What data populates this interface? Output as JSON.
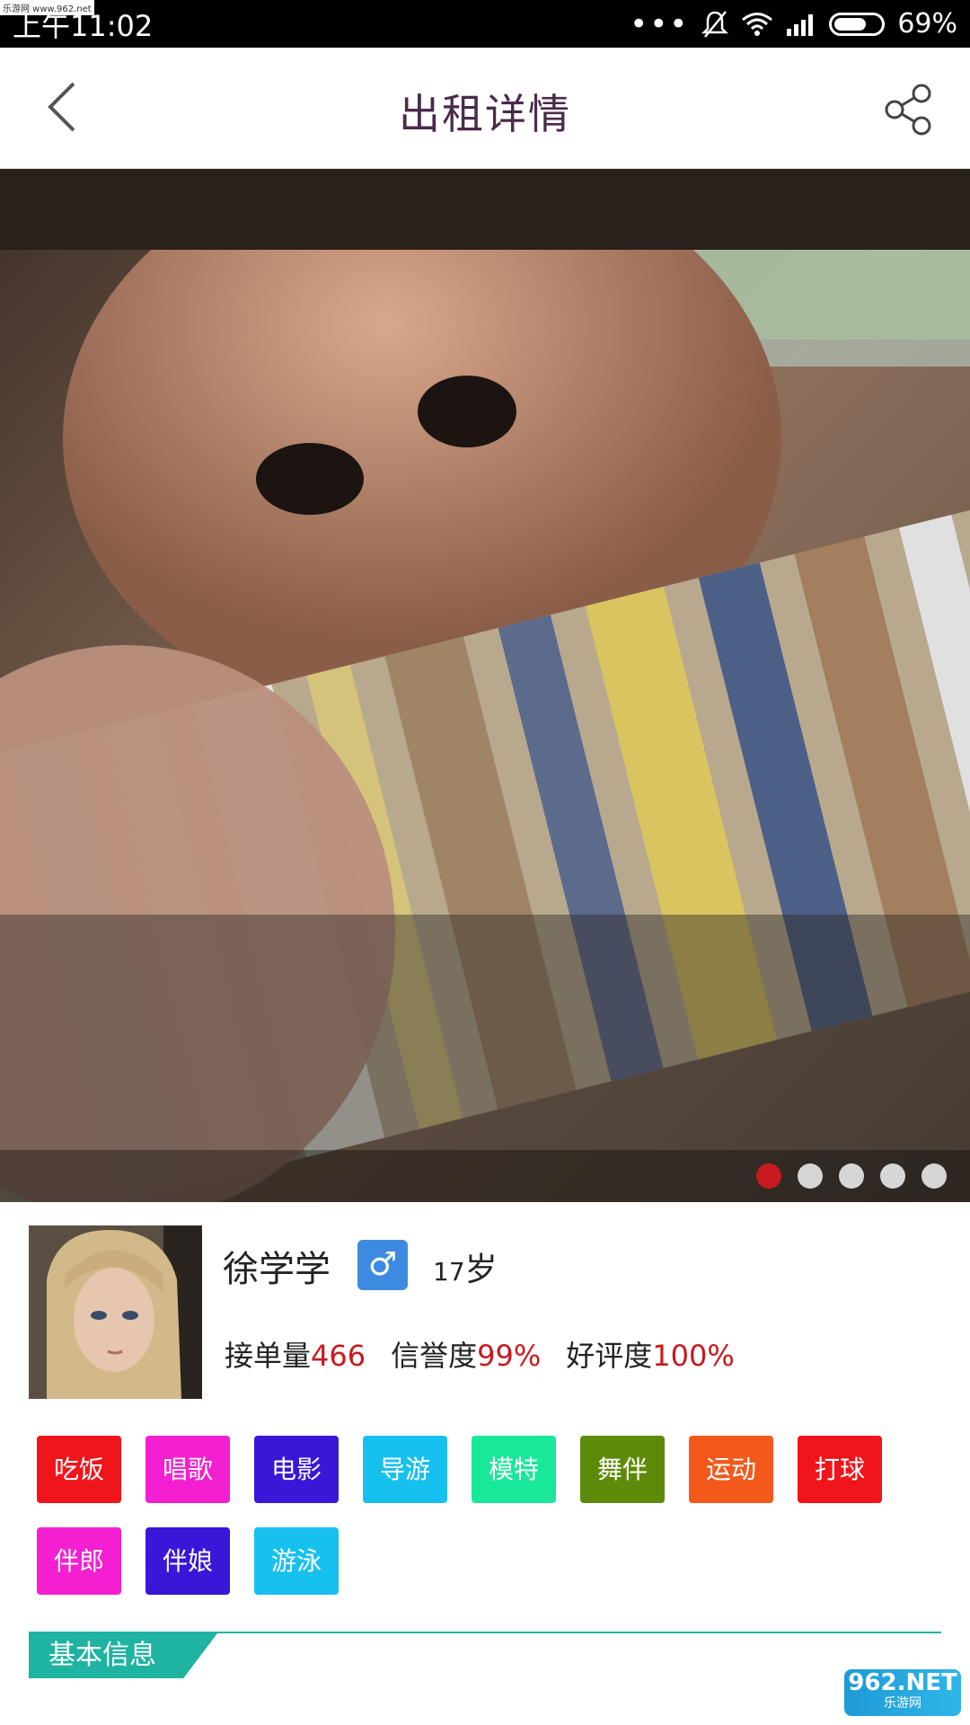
{
  "status_bar": {
    "time": "上午11:02",
    "battery": "69%",
    "battery_level": 0.69,
    "watermark_top": "乐游网 www.962.net"
  },
  "header": {
    "title": "出租详情",
    "back_icon": "chevron-left-icon",
    "share_icon": "share-icon"
  },
  "carousel": {
    "total": 5,
    "active_index": 0,
    "active_color": "#c8191e"
  },
  "profile": {
    "name": "徐学学",
    "gender_symbol": "♂",
    "age_number": "17",
    "age_unit": "岁",
    "stats": [
      {
        "label": "接单量",
        "value": "466"
      },
      {
        "label": "信誉度",
        "value": "99%"
      },
      {
        "label": "好评度",
        "value": "100%"
      }
    ]
  },
  "tags": [
    {
      "label": "吃饭",
      "color": "#f0151a"
    },
    {
      "label": "唱歌",
      "color": "#f31fd0"
    },
    {
      "label": "电影",
      "color": "#3a16d8"
    },
    {
      "label": "导游",
      "color": "#17c1ef"
    },
    {
      "label": "模特",
      "color": "#19e89a"
    },
    {
      "label": "舞伴",
      "color": "#5e8a09"
    },
    {
      "label": "运动",
      "color": "#f2591b"
    },
    {
      "label": "打球",
      "color": "#f0151a"
    },
    {
      "label": "伴郎",
      "color": "#f31fd0"
    },
    {
      "label": "伴娘",
      "color": "#3a16d8"
    },
    {
      "label": "游泳",
      "color": "#17c1ef"
    }
  ],
  "section": {
    "title": "基本信息",
    "color": "#1fb3a1"
  },
  "watermark": {
    "big": "962.NET",
    "small": "乐游网"
  }
}
